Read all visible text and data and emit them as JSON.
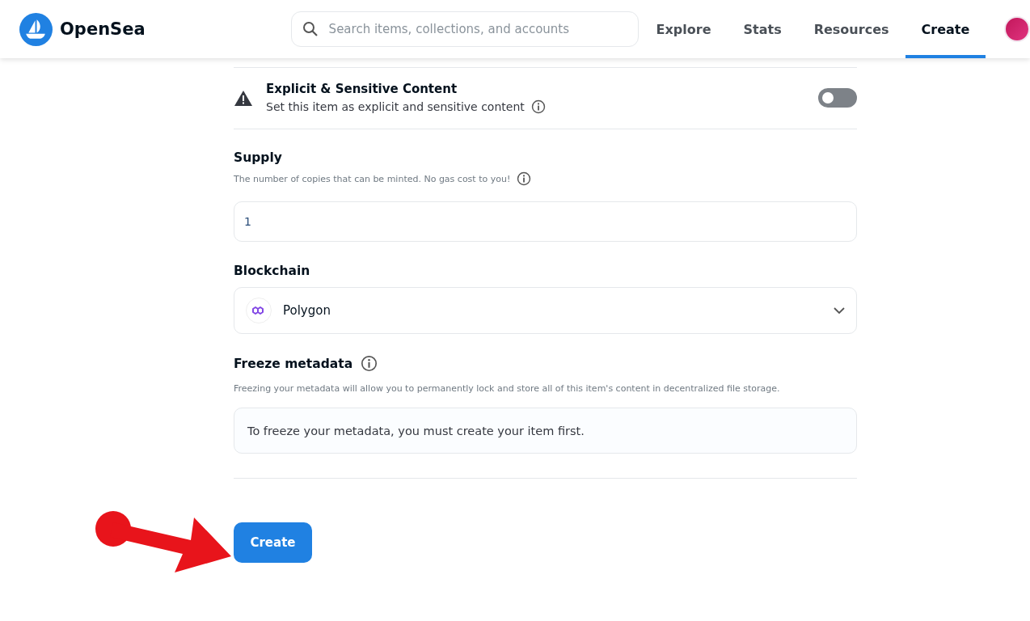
{
  "header": {
    "logo_text": "OpenSea",
    "search": {
      "placeholder": "Search items, collections, and accounts"
    },
    "nav": [
      {
        "label": "Explore",
        "selected": false
      },
      {
        "label": "Stats",
        "selected": false
      },
      {
        "label": "Resources",
        "selected": false
      },
      {
        "label": "Create",
        "selected": true
      }
    ]
  },
  "explicit": {
    "title": "Explicit & Sensitive Content",
    "description": "Set this item as explicit and sensitive content",
    "on": false
  },
  "supply": {
    "label": "Supply",
    "description": "The number of copies that can be minted. No gas cost to you!",
    "value": "1"
  },
  "blockchain": {
    "label": "Blockchain",
    "value": "Polygon"
  },
  "freeze": {
    "label": "Freeze metadata",
    "description": "Freezing your metadata will allow you to permanently lock and store all of this item's content in decentralized file storage.",
    "notice": "To freeze your metadata, you must create your item first."
  },
  "create_button": "Create"
}
